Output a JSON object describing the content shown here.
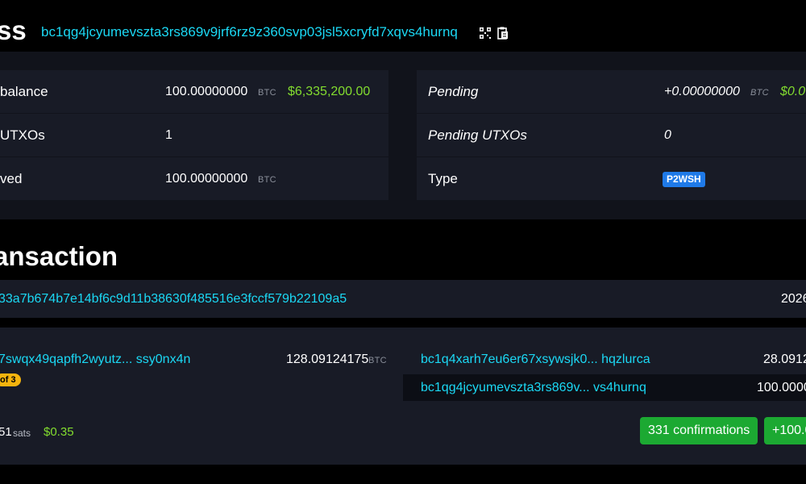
{
  "header": {
    "title": "ss",
    "address": "bc1qg4jcyumevszta3rs869v9jrf6rz9z360svp03jsl5xcryfd7xqvs4hurnq",
    "qr_icon": "qr-code-icon",
    "copy_icon": "clipboard-copy-icon"
  },
  "overview": {
    "left": [
      {
        "label": "balance",
        "amount": "100.00000000",
        "unit": "BTC",
        "fiat": "$6,335,200.00"
      },
      {
        "label": "UTXOs",
        "amount": "1"
      },
      {
        "label": "ved",
        "amount": "100.00000000",
        "unit": "BTC"
      }
    ],
    "right": [
      {
        "label": "Pending",
        "amount": "+0.00000000",
        "unit": "BTC",
        "fiat": "$0.0"
      },
      {
        "label": "Pending UTXOs",
        "amount": "0"
      },
      {
        "label": "Type",
        "badge": "P2WSH"
      }
    ]
  },
  "transactions": {
    "title": "ansaction",
    "txid": "33a7b674b7e14bf6c9d11b38630f485516e3fccf579b22109a5",
    "date": "2026",
    "input": {
      "address": "7swqx49qapfh2wyutz... ssy0nx4n",
      "amount": "128.09124175",
      "unit": "BTC",
      "badge": "of 3"
    },
    "outputs": [
      {
        "address": "bc1q4xarh7eu6er67xsywsjk0... hqzlurca",
        "amount": "28.0912"
      },
      {
        "address": "bc1qg4jcyumevszta3rs869v... vs4hurnq",
        "amount": "100.0000"
      }
    ],
    "fee": {
      "amount": "51",
      "unit": "sats",
      "fiat": "$0.35"
    },
    "confirmations": "331 confirmations",
    "net_amount": "+100.00"
  },
  "colors": {
    "accent": "#1bd8f4",
    "fiat": "#83dd2f",
    "panel": "#181b26",
    "badge_type": "#1f7ae8",
    "badge_multisig": "#f5b40e",
    "confirm": "#1ca932"
  }
}
